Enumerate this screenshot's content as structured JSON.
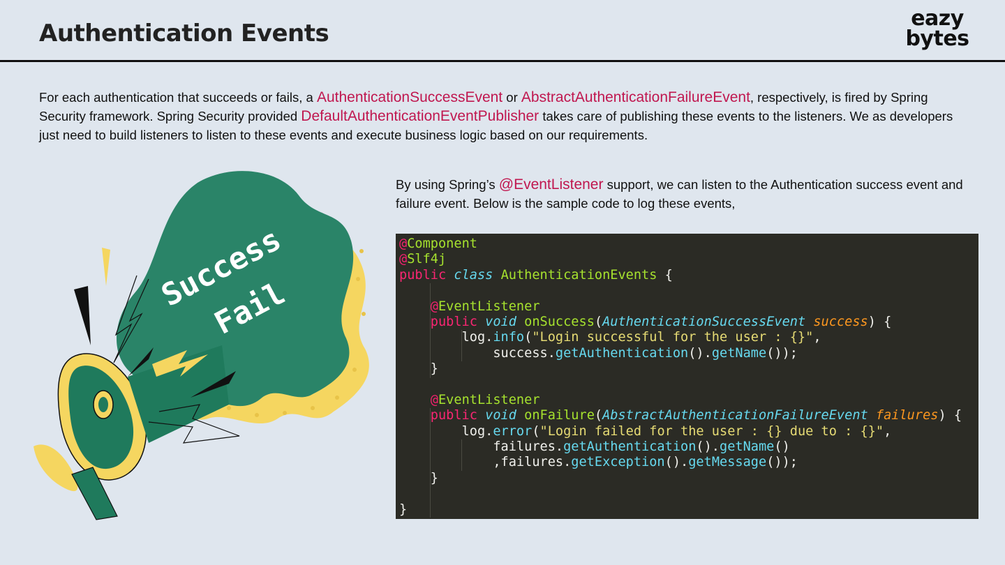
{
  "header": {
    "title": "Authentication Events",
    "logo_line1": "eazy",
    "logo_line2": "bytes"
  },
  "intro": {
    "t1": "For each authentication that succeeds or fails, a ",
    "h1": "AuthenticationSuccessEvent",
    "t2": " or ",
    "h2": "AbstractAuthenticationFailureEvent",
    "t3": ", respectively, is fired by Spring Security framework. Spring Security provided ",
    "h3": "DefaultAuthenticationEventPublisher",
    "t4": " takes care of publishing these events to the listeners. We as developers just need to build listeners to listen to these events and execute business logic based on our requirements."
  },
  "side": {
    "t1": "By using Spring’s ",
    "h1": "@EventListener",
    "t2": " support, we can listen to the Authentication success event and failure event. Below is the sample code to log these events,"
  },
  "illustration": {
    "word1": "Success",
    "word2": "Fail",
    "colors": {
      "cloud": "#2a8468",
      "cloud_edge": "#f5d660",
      "megaphone": "#1f7a5c"
    }
  },
  "code": {
    "l1_at": "@",
    "l1_ann": "Component",
    "l2_at": "@",
    "l2_ann": "Slf4j",
    "l3_kw": "public",
    "l3_kw2": "class",
    "l3_cls": "AuthenticationEvents",
    "l3_rest": " {",
    "l5_at": "@",
    "l5_ann": "EventListener",
    "l6_kw": "public",
    "l6_kw2": "void",
    "l6_fn": "onSuccess",
    "l6_p1": "(",
    "l6_ptype": "AuthenticationSuccessEvent",
    "l6_pname": "success",
    "l6_p2": ") {",
    "l7_a": "log.",
    "l7_m": "info",
    "l7_b": "(",
    "l7_s": "\"Login successful for the user : {}\"",
    "l7_c": ",",
    "l8_a": "success.",
    "l8_m": "getAuthentication",
    "l8_b": "().",
    "l8_m2": "getName",
    "l8_c": "());",
    "l9": "}",
    "l11_at": "@",
    "l11_ann": "EventListener",
    "l12_kw": "public",
    "l12_kw2": "void",
    "l12_fn": "onFailure",
    "l12_p1": "(",
    "l12_ptype": "AbstractAuthenticationFailureEvent",
    "l12_pname": "failures",
    "l12_p2": ") {",
    "l13_a": "log.",
    "l13_m": "error",
    "l13_b": "(",
    "l13_s": "\"Login failed for the user : {} due to : {}\"",
    "l13_c": ",",
    "l14_a": "failures.",
    "l14_m": "getAuthentication",
    "l14_b": "().",
    "l14_m2": "getName",
    "l14_c": "()",
    "l15_a": ",failures.",
    "l15_m": "getException",
    "l15_b": "().",
    "l15_m2": "getMessage",
    "l15_c": "());",
    "l16": "}",
    "l18": "}"
  }
}
